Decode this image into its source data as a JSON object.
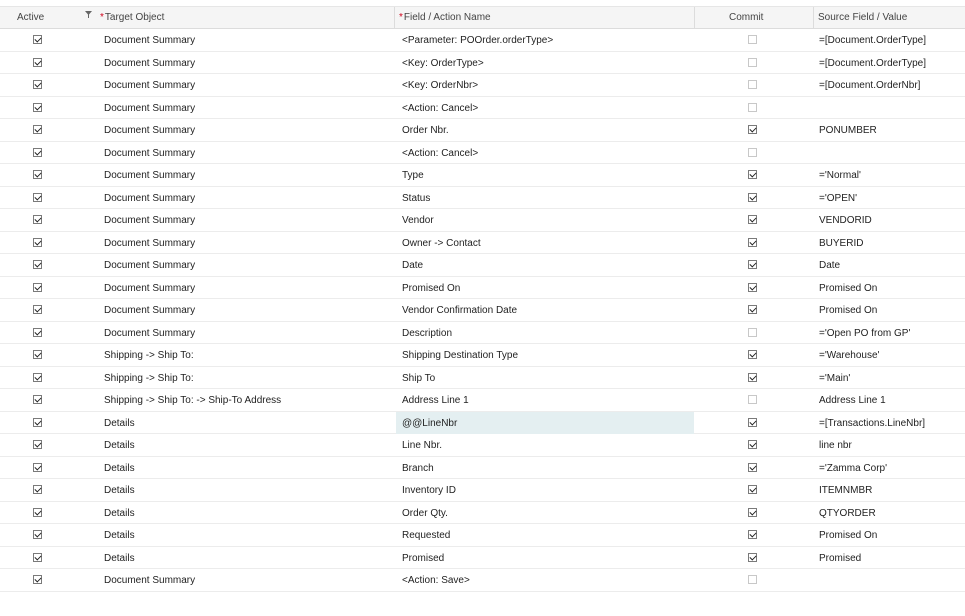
{
  "header": {
    "active": "Active",
    "target": "Target Object",
    "field": "Field / Action Name",
    "commit": "Commit",
    "source": "Source Field / Value",
    "required_mark": "*"
  },
  "rows": [
    {
      "active": true,
      "target": "Document Summary",
      "field": "<Parameter: POOrder.orderType>",
      "commit": false,
      "source": "=[Document.OrderType]"
    },
    {
      "active": true,
      "target": "Document Summary",
      "field": "<Key: OrderType>",
      "commit": false,
      "source": "=[Document.OrderType]"
    },
    {
      "active": true,
      "target": "Document Summary",
      "field": "<Key: OrderNbr>",
      "commit": false,
      "source": "=[Document.OrderNbr]"
    },
    {
      "active": true,
      "target": "Document Summary",
      "field": "<Action: Cancel>",
      "commit": false,
      "source": ""
    },
    {
      "active": true,
      "target": "Document Summary",
      "field": "Order Nbr.",
      "commit": true,
      "source": "PONUMBER"
    },
    {
      "active": true,
      "target": "Document Summary",
      "field": "<Action: Cancel>",
      "commit": false,
      "source": ""
    },
    {
      "active": true,
      "target": "Document Summary",
      "field": "Type",
      "commit": true,
      "source": "='Normal'"
    },
    {
      "active": true,
      "target": "Document Summary",
      "field": "Status",
      "commit": true,
      "source": "='OPEN'"
    },
    {
      "active": true,
      "target": "Document Summary",
      "field": "Vendor",
      "commit": true,
      "source": "VENDORID"
    },
    {
      "active": true,
      "target": "Document Summary",
      "field": "Owner -> Contact",
      "commit": true,
      "source": "BUYERID"
    },
    {
      "active": true,
      "target": "Document Summary",
      "field": "Date",
      "commit": true,
      "source": "Date"
    },
    {
      "active": true,
      "target": "Document Summary",
      "field": "Promised On",
      "commit": true,
      "source": "Promised On"
    },
    {
      "active": true,
      "target": "Document Summary",
      "field": "Vendor Confirmation Date",
      "commit": true,
      "source": "Promised On"
    },
    {
      "active": true,
      "target": "Document Summary",
      "field": "Description",
      "commit": false,
      "source": "='Open PO from GP'"
    },
    {
      "active": true,
      "target": "Shipping -> Ship To:",
      "field": "Shipping Destination Type",
      "commit": true,
      "source": "='Warehouse'"
    },
    {
      "active": true,
      "target": "Shipping -> Ship To:",
      "field": "Ship To",
      "commit": true,
      "source": "='Main'"
    },
    {
      "active": true,
      "target": "Shipping -> Ship To: -> Ship-To Address",
      "field": "Address Line 1",
      "commit": false,
      "source": "Address Line 1"
    },
    {
      "active": true,
      "target": "Details",
      "field": "@@LineNbr",
      "commit": true,
      "source": "=[Transactions.LineNbr]",
      "selected": true
    },
    {
      "active": true,
      "target": "Details",
      "field": "Line Nbr.",
      "commit": true,
      "source": "line nbr"
    },
    {
      "active": true,
      "target": "Details",
      "field": "Branch",
      "commit": true,
      "source": "='Zamma Corp'"
    },
    {
      "active": true,
      "target": "Details",
      "field": "Inventory ID",
      "commit": true,
      "source": "ITEMNMBR"
    },
    {
      "active": true,
      "target": "Details",
      "field": "Order Qty.",
      "commit": true,
      "source": "QTYORDER"
    },
    {
      "active": true,
      "target": "Details",
      "field": "Requested",
      "commit": true,
      "source": "Promised On"
    },
    {
      "active": true,
      "target": "Details",
      "field": "Promised",
      "commit": true,
      "source": "Promised"
    },
    {
      "active": true,
      "target": "Document Summary",
      "field": "<Action: Save>",
      "commit": false,
      "source": ""
    }
  ]
}
